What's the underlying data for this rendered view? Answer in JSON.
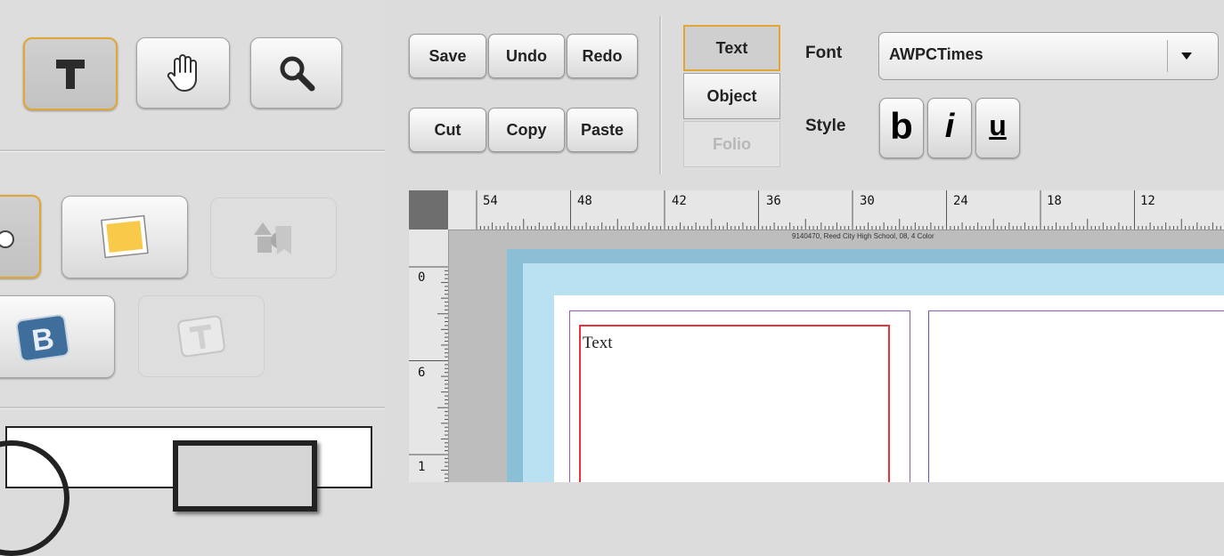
{
  "toolbar": {
    "save_label": "Save",
    "undo_label": "Undo",
    "redo_label": "Redo",
    "cut_label": "Cut",
    "copy_label": "Copy",
    "paste_label": "Paste"
  },
  "modes": {
    "text_label": "Text",
    "object_label": "Object",
    "folio_label": "Folio",
    "selected": "Text"
  },
  "font": {
    "label": "Font",
    "value": "AWPCTimes"
  },
  "style": {
    "label": "Style",
    "bold_label": "b",
    "italic_label": "i",
    "underline_label": "u"
  },
  "tools": [
    "text-tool",
    "hand-tool",
    "zoom-tool"
  ],
  "ruler": {
    "horizontal_labels": [
      "54",
      "48",
      "42",
      "36",
      "30",
      "24",
      "18",
      "12"
    ],
    "vertical_labels": [
      "0",
      "6",
      "1"
    ],
    "page_info": "9140470, Reed City High School, 08, 4 Color"
  },
  "canvas": {
    "text_box_content": "Text"
  },
  "colors": {
    "selected_border": "#e0a735",
    "page_bleed": "#b9e1f2",
    "page_frame": "#8bbfd6",
    "safety_margin": "#9b59b6",
    "text_box_border": "#e8333a"
  }
}
